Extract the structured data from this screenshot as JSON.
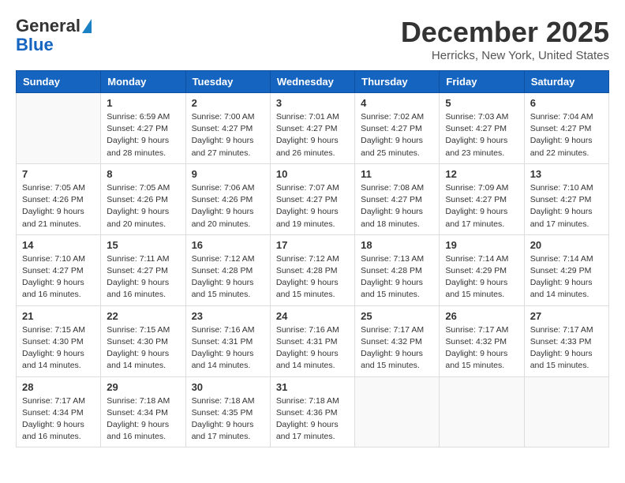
{
  "header": {
    "logo_line1": "General",
    "logo_line2": "Blue",
    "month": "December 2025",
    "location": "Herricks, New York, United States"
  },
  "weekdays": [
    "Sunday",
    "Monday",
    "Tuesday",
    "Wednesday",
    "Thursday",
    "Friday",
    "Saturday"
  ],
  "weeks": [
    [
      {
        "day": "",
        "info": ""
      },
      {
        "day": "1",
        "info": "Sunrise: 6:59 AM\nSunset: 4:27 PM\nDaylight: 9 hours\nand 28 minutes."
      },
      {
        "day": "2",
        "info": "Sunrise: 7:00 AM\nSunset: 4:27 PM\nDaylight: 9 hours\nand 27 minutes."
      },
      {
        "day": "3",
        "info": "Sunrise: 7:01 AM\nSunset: 4:27 PM\nDaylight: 9 hours\nand 26 minutes."
      },
      {
        "day": "4",
        "info": "Sunrise: 7:02 AM\nSunset: 4:27 PM\nDaylight: 9 hours\nand 25 minutes."
      },
      {
        "day": "5",
        "info": "Sunrise: 7:03 AM\nSunset: 4:27 PM\nDaylight: 9 hours\nand 23 minutes."
      },
      {
        "day": "6",
        "info": "Sunrise: 7:04 AM\nSunset: 4:27 PM\nDaylight: 9 hours\nand 22 minutes."
      }
    ],
    [
      {
        "day": "7",
        "info": "Sunrise: 7:05 AM\nSunset: 4:26 PM\nDaylight: 9 hours\nand 21 minutes."
      },
      {
        "day": "8",
        "info": "Sunrise: 7:05 AM\nSunset: 4:26 PM\nDaylight: 9 hours\nand 20 minutes."
      },
      {
        "day": "9",
        "info": "Sunrise: 7:06 AM\nSunset: 4:26 PM\nDaylight: 9 hours\nand 20 minutes."
      },
      {
        "day": "10",
        "info": "Sunrise: 7:07 AM\nSunset: 4:27 PM\nDaylight: 9 hours\nand 19 minutes."
      },
      {
        "day": "11",
        "info": "Sunrise: 7:08 AM\nSunset: 4:27 PM\nDaylight: 9 hours\nand 18 minutes."
      },
      {
        "day": "12",
        "info": "Sunrise: 7:09 AM\nSunset: 4:27 PM\nDaylight: 9 hours\nand 17 minutes."
      },
      {
        "day": "13",
        "info": "Sunrise: 7:10 AM\nSunset: 4:27 PM\nDaylight: 9 hours\nand 17 minutes."
      }
    ],
    [
      {
        "day": "14",
        "info": "Sunrise: 7:10 AM\nSunset: 4:27 PM\nDaylight: 9 hours\nand 16 minutes."
      },
      {
        "day": "15",
        "info": "Sunrise: 7:11 AM\nSunset: 4:27 PM\nDaylight: 9 hours\nand 16 minutes."
      },
      {
        "day": "16",
        "info": "Sunrise: 7:12 AM\nSunset: 4:28 PM\nDaylight: 9 hours\nand 15 minutes."
      },
      {
        "day": "17",
        "info": "Sunrise: 7:12 AM\nSunset: 4:28 PM\nDaylight: 9 hours\nand 15 minutes."
      },
      {
        "day": "18",
        "info": "Sunrise: 7:13 AM\nSunset: 4:28 PM\nDaylight: 9 hours\nand 15 minutes."
      },
      {
        "day": "19",
        "info": "Sunrise: 7:14 AM\nSunset: 4:29 PM\nDaylight: 9 hours\nand 15 minutes."
      },
      {
        "day": "20",
        "info": "Sunrise: 7:14 AM\nSunset: 4:29 PM\nDaylight: 9 hours\nand 14 minutes."
      }
    ],
    [
      {
        "day": "21",
        "info": "Sunrise: 7:15 AM\nSunset: 4:30 PM\nDaylight: 9 hours\nand 14 minutes."
      },
      {
        "day": "22",
        "info": "Sunrise: 7:15 AM\nSunset: 4:30 PM\nDaylight: 9 hours\nand 14 minutes."
      },
      {
        "day": "23",
        "info": "Sunrise: 7:16 AM\nSunset: 4:31 PM\nDaylight: 9 hours\nand 14 minutes."
      },
      {
        "day": "24",
        "info": "Sunrise: 7:16 AM\nSunset: 4:31 PM\nDaylight: 9 hours\nand 14 minutes."
      },
      {
        "day": "25",
        "info": "Sunrise: 7:17 AM\nSunset: 4:32 PM\nDaylight: 9 hours\nand 15 minutes."
      },
      {
        "day": "26",
        "info": "Sunrise: 7:17 AM\nSunset: 4:32 PM\nDaylight: 9 hours\nand 15 minutes."
      },
      {
        "day": "27",
        "info": "Sunrise: 7:17 AM\nSunset: 4:33 PM\nDaylight: 9 hours\nand 15 minutes."
      }
    ],
    [
      {
        "day": "28",
        "info": "Sunrise: 7:17 AM\nSunset: 4:34 PM\nDaylight: 9 hours\nand 16 minutes."
      },
      {
        "day": "29",
        "info": "Sunrise: 7:18 AM\nSunset: 4:34 PM\nDaylight: 9 hours\nand 16 minutes."
      },
      {
        "day": "30",
        "info": "Sunrise: 7:18 AM\nSunset: 4:35 PM\nDaylight: 9 hours\nand 17 minutes."
      },
      {
        "day": "31",
        "info": "Sunrise: 7:18 AM\nSunset: 4:36 PM\nDaylight: 9 hours\nand 17 minutes."
      },
      {
        "day": "",
        "info": ""
      },
      {
        "day": "",
        "info": ""
      },
      {
        "day": "",
        "info": ""
      }
    ]
  ]
}
